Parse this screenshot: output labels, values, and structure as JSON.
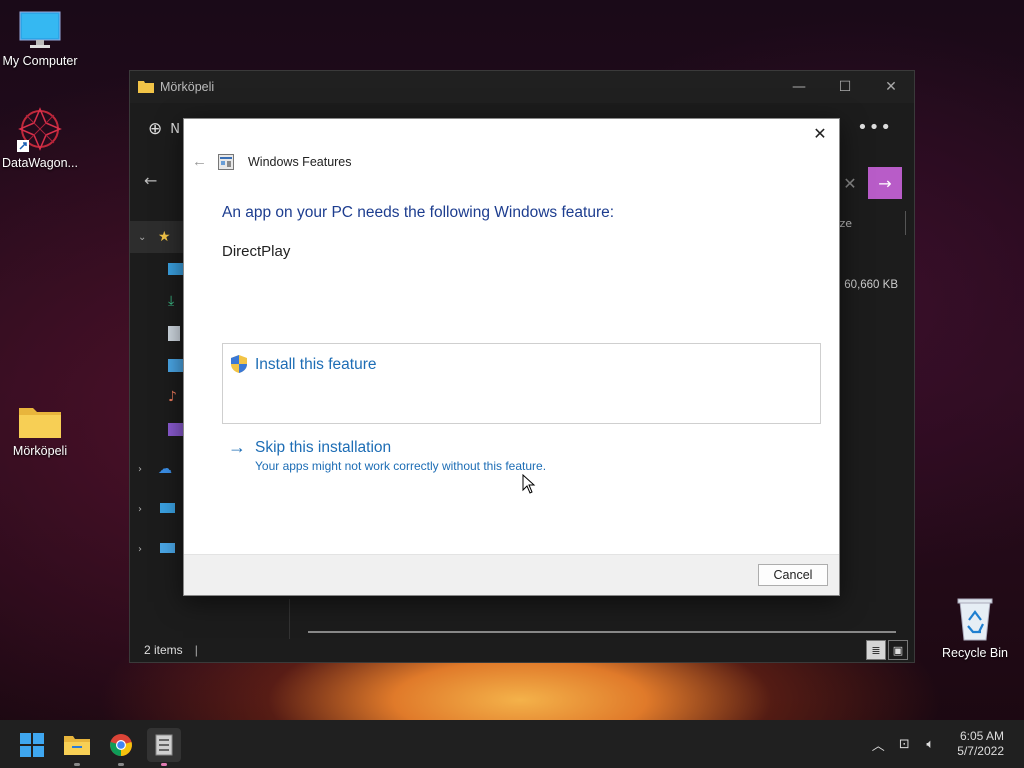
{
  "desktop": {
    "icons": [
      {
        "label": "My Computer"
      },
      {
        "label": "DataWagon..."
      },
      {
        "label": "Mörköpeli"
      },
      {
        "label": "Recycle Bin"
      }
    ]
  },
  "explorer": {
    "title": "Mörköpeli",
    "toolbar_new_partial": "N",
    "column_size_partial": "ze",
    "file_size": "60,660 KB",
    "status": "2 items",
    "status_sep": "|"
  },
  "dialog": {
    "title": "Windows Features",
    "message": "An app on your PC needs the following Windows feature:",
    "feature_name": "DirectPlay",
    "install_label": "Install this feature",
    "skip_label": "Skip this installation",
    "skip_sub": "Your apps might not work correctly without this feature.",
    "cancel_label": "Cancel"
  },
  "taskbar": {
    "time": "6:05 AM",
    "date": "5/7/2022"
  },
  "colors": {
    "accent_link": "#1d6db5",
    "heading_blue": "#1d3d8f",
    "search_go": "#b85cc8"
  }
}
